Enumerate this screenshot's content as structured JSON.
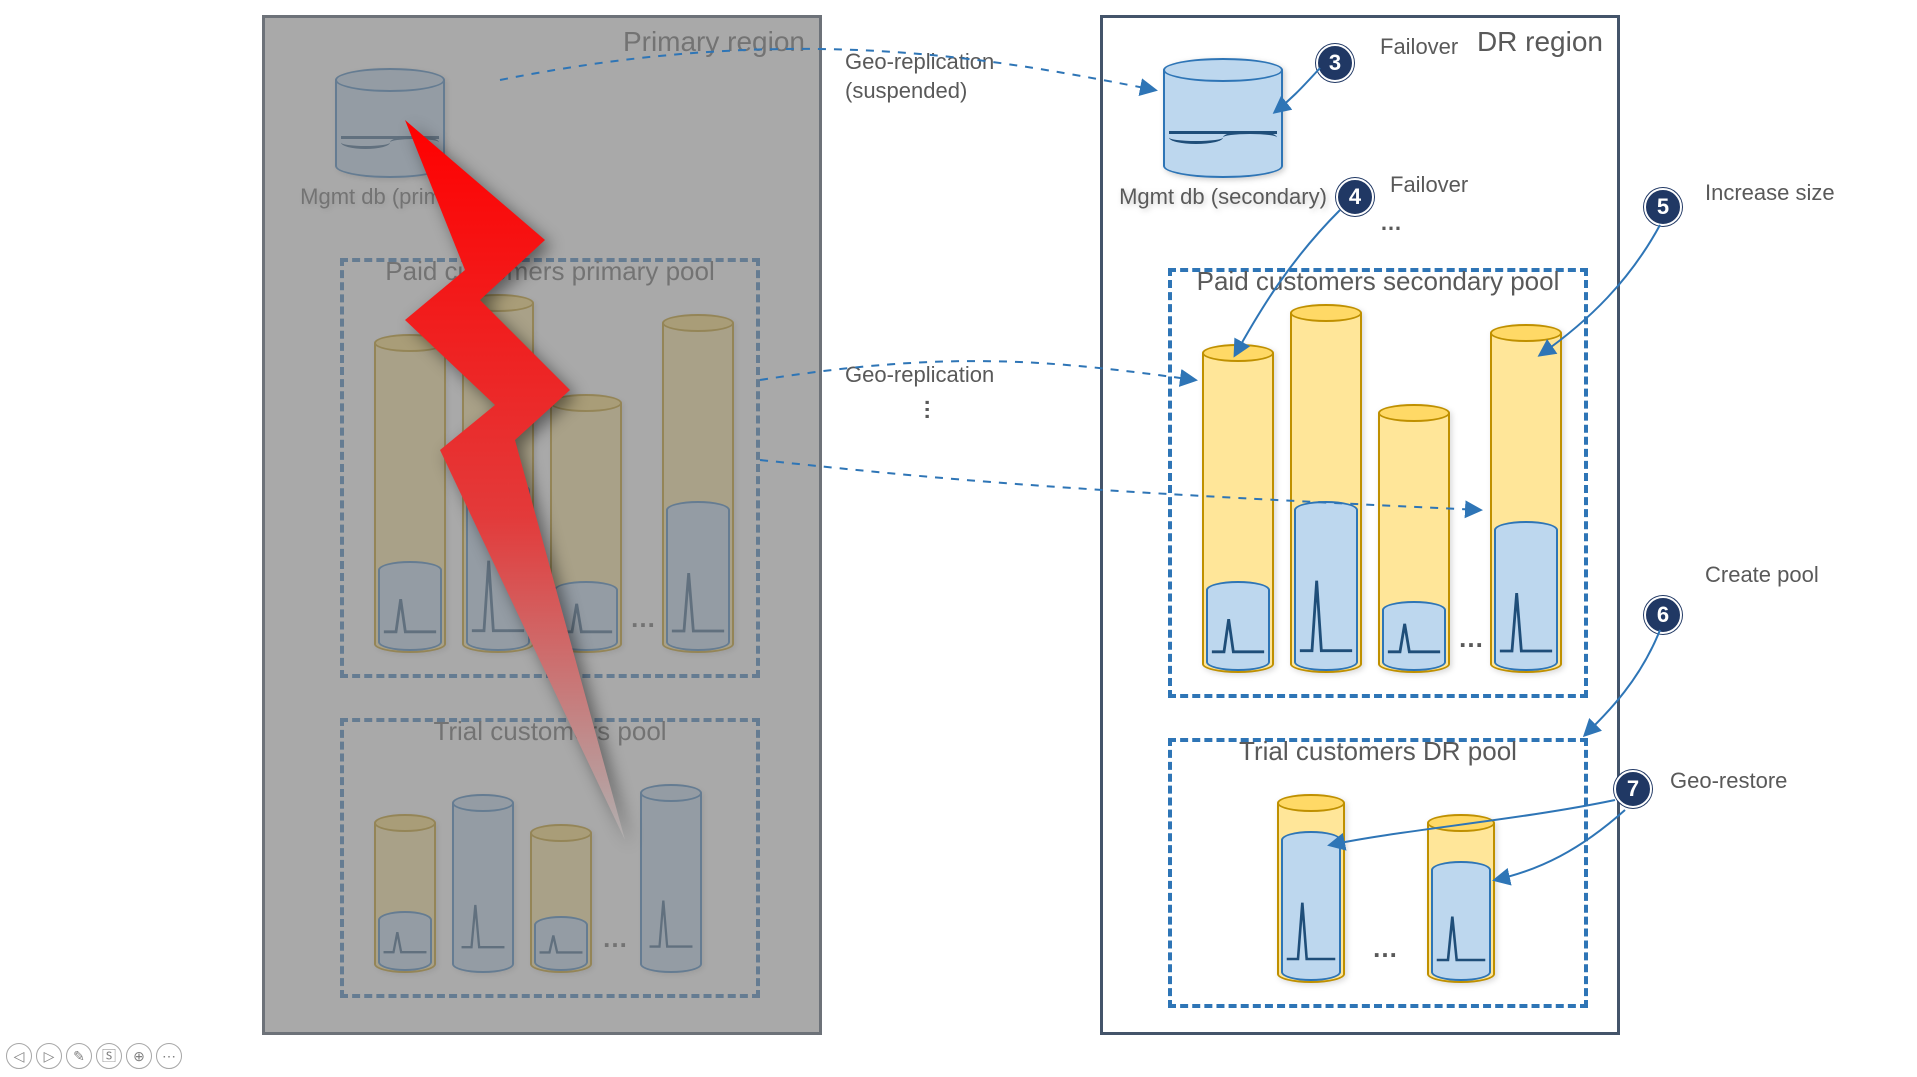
{
  "primary_region": {
    "title": "Primary region",
    "mgmt_db_label": "Mgmt db (primary)",
    "paid_pool_title": "Paid customers primary pool",
    "trial_pool_title": "Trial customers pool"
  },
  "dr_region": {
    "title": "DR region",
    "mgmt_db_label": "Mgmt db (secondary)",
    "paid_pool_title": "Paid customers secondary pool",
    "trial_pool_title": "Trial customers DR pool"
  },
  "connectors": {
    "geo_replication_suspended_line1": "Geo-replication",
    "geo_replication_suspended_line2": "(suspended)",
    "geo_replication": "Geo-replication"
  },
  "steps": {
    "s3": {
      "num": "3",
      "label": "Failover"
    },
    "s4": {
      "num": "4",
      "label": "Failover"
    },
    "s5": {
      "num": "5",
      "label": "Increase size"
    },
    "s6": {
      "num": "6",
      "label": "Create pool"
    },
    "s7": {
      "num": "7",
      "label": "Geo-restore"
    }
  },
  "icons": {
    "prev": "◁",
    "next": "▷",
    "pen": "✎",
    "subtitle": "🅂",
    "zoom": "⊕",
    "more": "⋯"
  }
}
